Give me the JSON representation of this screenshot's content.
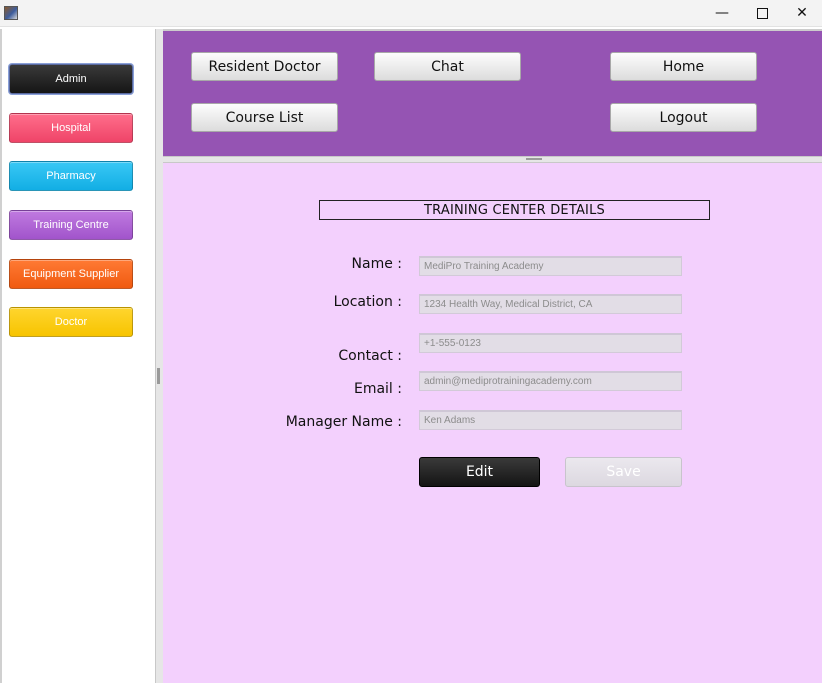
{
  "window": {
    "minimize_glyph": "—",
    "close_glyph": "✕"
  },
  "sidebar": {
    "items": [
      {
        "label": "Admin",
        "color": "#1f1f1f"
      },
      {
        "label": "Hospital",
        "color": "#f5506f"
      },
      {
        "label": "Pharmacy",
        "color": "#1ab8ec"
      },
      {
        "label": "Training Centre",
        "color": "#ad62d4"
      },
      {
        "label": "Equipment Supplier",
        "color": "#f56418"
      },
      {
        "label": "Doctor",
        "color": "#fbcb10"
      }
    ]
  },
  "toolbar": {
    "resident_doctor": "Resident Doctor",
    "chat": "Chat",
    "home": "Home",
    "course_list": "Course List",
    "logout": "Logout"
  },
  "details": {
    "title": "TRAINING CENTER DETAILS",
    "name_label": "Name :",
    "name_value": "MediPro Training Academy",
    "location_label": "Location :",
    "location_value": "1234 Health Way, Medical District, CA",
    "contact_label": "Contact :",
    "contact_value": "+1-555-0123",
    "email_label": "Email :",
    "email_value": "admin@mediprotrainingacademy.com",
    "manager_label": "Manager Name :",
    "manager_value": "Ken Adams",
    "edit_label": "Edit",
    "save_label": "Save"
  },
  "colors": {
    "top_panel": "#9554b3",
    "main_background": "#f3d0fd"
  }
}
